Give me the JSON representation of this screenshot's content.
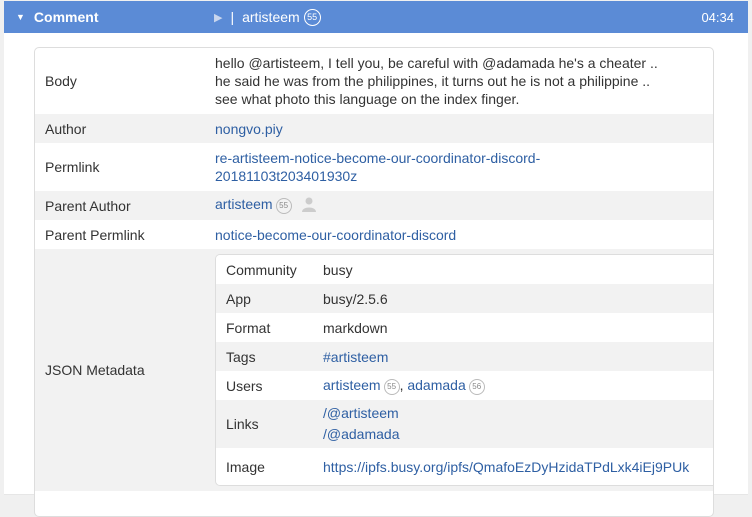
{
  "header": {
    "title": "Comment",
    "author": "artisteem",
    "author_rep": "55",
    "time": "04:34"
  },
  "fields": {
    "body": {
      "label": "Body",
      "lines": [
        "hello @artisteem, I tell you, be careful with @adamada he's a cheater ..",
        "he said he was from the philippines, it turns out he is not a philippine ..",
        "see what photo this language on the index finger."
      ]
    },
    "author": {
      "label": "Author",
      "value": "nongvo.piy"
    },
    "permlink": {
      "label": "Permlink",
      "lines": [
        "re-artisteem-notice-become-our-coordinator-discord-",
        "20181103t203401930z"
      ]
    },
    "parent_author": {
      "label": "Parent Author",
      "value": "artisteem",
      "rep": "55"
    },
    "parent_permlink": {
      "label": "Parent Permlink",
      "value": "notice-become-our-coordinator-discord"
    },
    "json_metadata": {
      "label": "JSON Metadata",
      "community": {
        "label": "Community",
        "value": "busy"
      },
      "app": {
        "label": "App",
        "value": "busy/2.5.6"
      },
      "format": {
        "label": "Format",
        "value": "markdown"
      },
      "tags": {
        "label": "Tags",
        "value": "#artisteem"
      },
      "users": {
        "label": "Users",
        "items": [
          {
            "name": "artisteem",
            "rep": "55"
          },
          {
            "name": "adamada",
            "rep": "56"
          }
        ],
        "separator": ","
      },
      "links": {
        "label": "Links",
        "items": [
          "/@artisteem",
          "/@adamada"
        ]
      },
      "image": {
        "label": "Image",
        "value": "https://ipfs.busy.org/ipfs/QmafoEzDyHzidaTPdLxk4iEj9PUk"
      }
    }
  }
}
